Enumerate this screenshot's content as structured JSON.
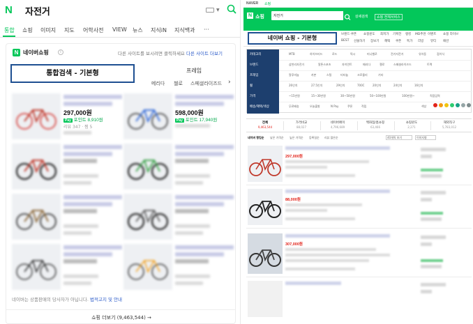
{
  "mobile": {
    "logo": "N",
    "query": "자전거",
    "tabs": [
      "통합",
      "쇼핑",
      "이미지",
      "지도",
      "어학사전",
      "VIEW",
      "뉴스",
      "지식iN",
      "지식백과",
      "···"
    ],
    "shopping_title": "네이버쇼핑",
    "info_icon": "i",
    "compare_text": "다른 사이트를 보시려면 클릭하세요",
    "compare_link": "다른 사이트 더보기",
    "label": "통합검색 - 기본형",
    "frame_label": "프레임",
    "chips": [
      "메리다",
      "첼로",
      "스페셜라이즈드"
    ],
    "products": [
      {
        "price": "297,000원",
        "pay_badge": "Pay",
        "pay_text": "포인트 8,910원",
        "meta": "리뷰 347 · 찜 5"
      },
      {
        "price": "598,000원",
        "pay_badge": "Pay",
        "pay_text": "포인트 17,940원",
        "meta": ""
      },
      {
        "price": "",
        "pay_badge": "",
        "pay_text": "",
        "meta": ""
      },
      {
        "price": "",
        "pay_badge": "",
        "pay_text": "",
        "meta": ""
      },
      {
        "price": "",
        "pay_badge": "",
        "pay_text": "",
        "meta": ""
      },
      {
        "price": "",
        "pay_badge": "",
        "pay_text": "",
        "meta": ""
      },
      {
        "price": "",
        "pay_badge": "",
        "pay_text": "",
        "meta": ""
      },
      {
        "price": "",
        "pay_badge": "",
        "pay_text": "",
        "meta": ""
      }
    ],
    "notice": "네이버는 상품판매의 당사자가 아닙니다.",
    "notice_link": "법적고지 및 안내",
    "more_button": "쇼핑 더보기 (9,463,544) →"
  },
  "pc": {
    "top_brand": "NAVER",
    "top_sub": "쇼핑",
    "logo": "N",
    "shop_label": "쇼핑",
    "query": "자전거",
    "header_links": [
      "상세검색",
      "쇼핑 전체서비스"
    ],
    "label": "네이버 쇼핑 - 기본형",
    "gnb_items": [
      "브랜드·쿠폰",
      "쇼핑윈도",
      "최저가",
      "기획전",
      "랭킹",
      "MD추천",
      "이벤트",
      "쇼핑 라이브",
      "BEST",
      "선물하기",
      "장보기",
      "혜택",
      "쿠폰",
      "특가",
      "리빙",
      "뷰티",
      "패션"
    ],
    "filter_labels": [
      "카테고리",
      "브랜드",
      "프레임",
      "휠",
      "가격",
      "배송/혜택/색상"
    ],
    "filter_rows": [
      [
        "MTB",
        "하이브리드",
        "로드",
        "픽시",
        "미니벨로",
        "전기자전거",
        "유아동",
        "접이식"
      ],
      [
        "삼천리자전거",
        "알톤스포츠",
        "자이언트",
        "메리다",
        "첼로",
        "스페셜라이즈드",
        "트렉"
      ],
      [
        "알루미늄",
        "카본",
        "스틸",
        "티타늄",
        "크로몰리",
        "기타"
      ],
      [
        "26인치",
        "27.5인치",
        "29인치",
        "700C",
        "20인치",
        "24인치",
        "16인치"
      ],
      [
        "~15만원",
        "15~30만원",
        "30~50만원",
        "50~100만원",
        "100만원~",
        "직접입력"
      ],
      [
        "무료배송",
        "오늘출발",
        "N Pay",
        "쿠폰",
        "적립",
        "색상"
      ]
    ],
    "color_dots": [
      "#e2231a",
      "#f39c12",
      "#f1c40f",
      "#2ecc71",
      "#16a085",
      "#95a5a6",
      "#7f8c8d"
    ],
    "category_tabs": [
      {
        "label": "전체",
        "count": "9,463,544"
      },
      {
        "label": "가격비교",
        "count": "88,027"
      },
      {
        "label": "네이버페이",
        "count": "4,796,689"
      },
      {
        "label": "백화점/홈쇼핑",
        "count": "63,466"
      },
      {
        "label": "쇼핑윈도",
        "count": "2,271"
      },
      {
        "label": "해외직구",
        "count": "5,783,012"
      }
    ],
    "sort_items": [
      "네이버 랭킹순",
      "낮은 가격순",
      "높은 가격순",
      "등록일순",
      "리뷰 많은순"
    ],
    "sort_selects": [
      "40개씩 보기",
      "이미지형"
    ],
    "items": [
      {
        "price": "297,000원"
      },
      {
        "price": "88,000원"
      },
      {
        "price": "307,000원"
      }
    ]
  }
}
